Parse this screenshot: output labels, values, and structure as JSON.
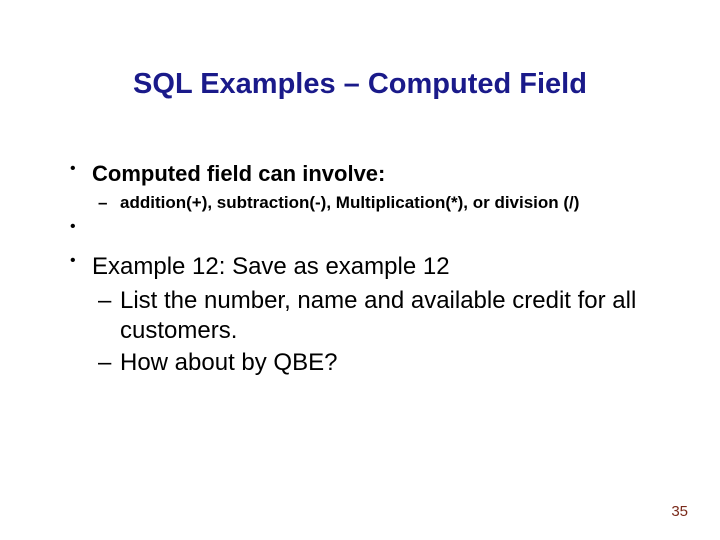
{
  "title": "SQL Examples – Computed Field",
  "bullets": {
    "item1": {
      "text": "Computed field can involve:",
      "sub1": "addition(+), subtraction(-), Multiplication(*), or division (/)"
    },
    "item2": {
      "text": "Example 12: Save as example 12",
      "sub1": "List the number, name and available credit for all customers.",
      "sub2": "How about by QBE?"
    }
  },
  "page_number": "35"
}
